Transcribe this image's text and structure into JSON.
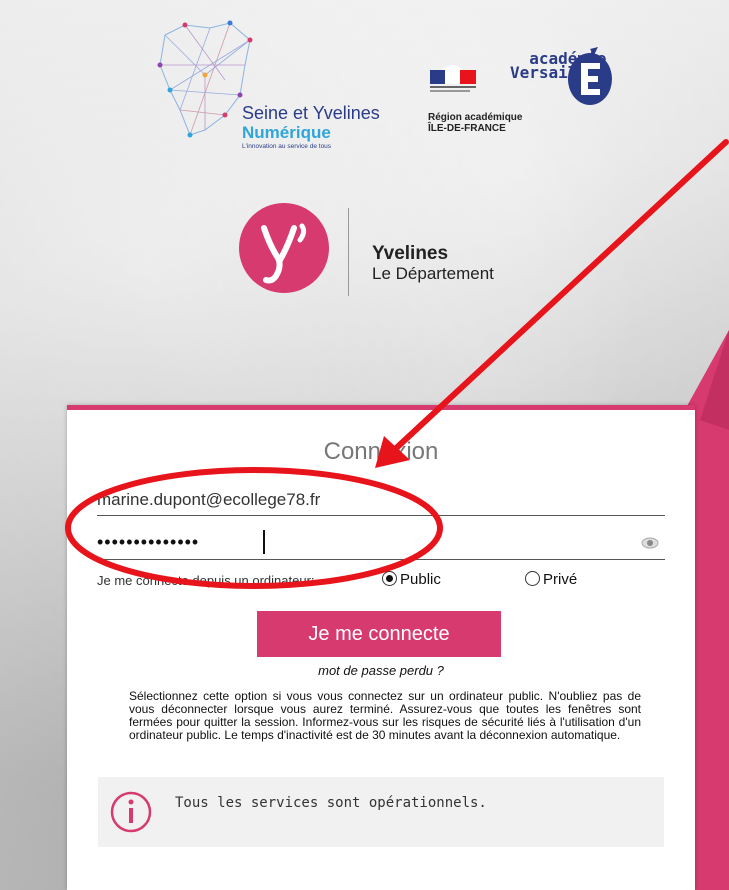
{
  "logos": {
    "syn_title": "Seine et Yvelines",
    "syn_sub": "Numérique",
    "syn_tagline": "L'innovation au service de tous",
    "region_line1": "Région académique",
    "region_line2": "ÎLE-DE-FRANCE",
    "acad_line1": "académie",
    "acad_line2": "Versailles",
    "yv_title": "Yvelines",
    "yv_sub": "Le Département"
  },
  "login": {
    "title": "Connexion",
    "email_value": "marine.dupont@ecollege78.fr",
    "password_masked": "••••••••••••••",
    "device_label": "Je me connecte depuis un ordinateur:",
    "option_public": "Public",
    "option_private": "Privé",
    "selected_option": "Public",
    "submit_label": "Je me connecte",
    "forgot_label": "mot de passe perdu ?",
    "info_text": "Sélectionnez cette option si vous vous connectez sur un ordinateur public. N'oubliez pas de vous déconnecter lorsque vous aurez terminé. Assurez-vous que toutes les fenêtres sont fermées pour quitter la session. Informez-vous sur les risques de sécurité liés à l'utilisation d'un ordinateur public. Le temps d'inactivité est de 30 minutes avant la déconnexion automatique.",
    "status_text": "Tous les services sont opérationnels."
  },
  "colors": {
    "accent": "#d63a6f",
    "annotation": "#e8141b"
  }
}
